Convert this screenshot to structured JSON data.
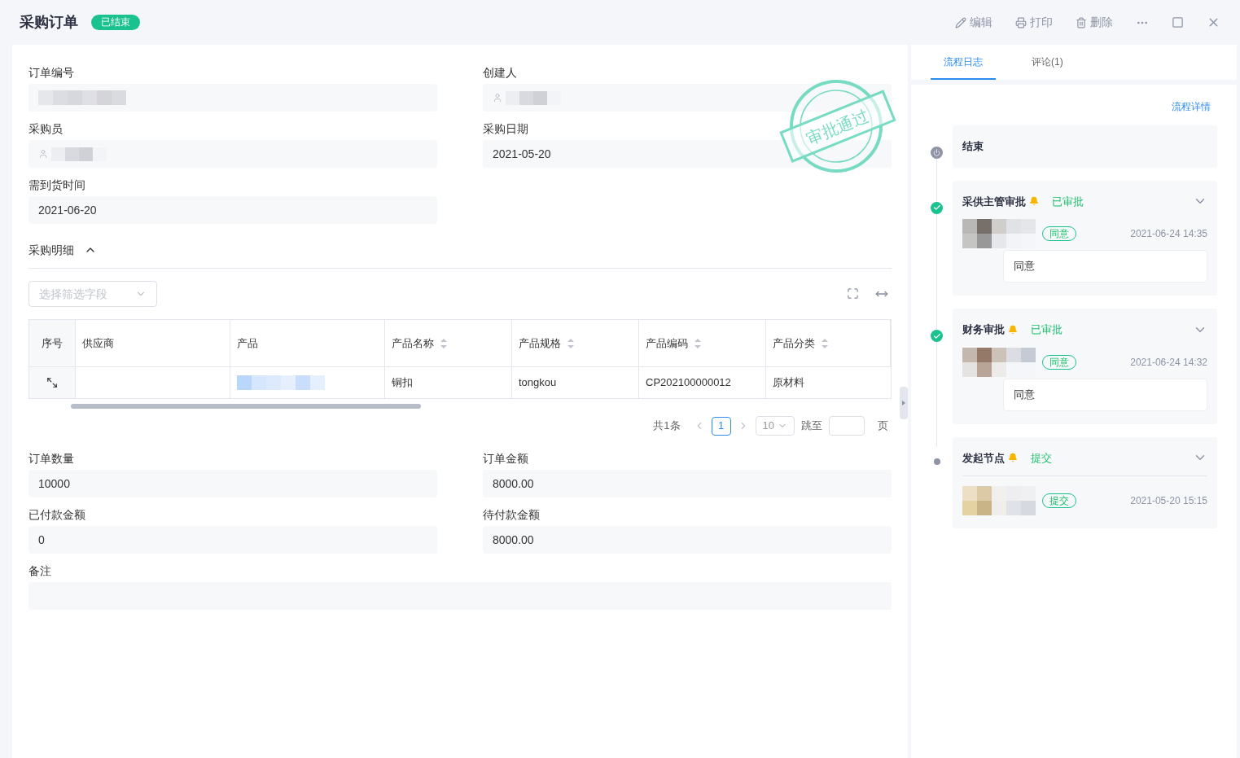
{
  "header": {
    "title": "采购订单",
    "status": "已结束",
    "actions": [
      {
        "kind": "edit",
        "label": "编辑"
      },
      {
        "kind": "print",
        "label": "打印"
      },
      {
        "kind": "delete",
        "label": "删除"
      }
    ]
  },
  "form_top": [
    {
      "label": "订单编号",
      "kind": "redacted"
    },
    {
      "label": "创建人",
      "kind": "user"
    },
    {
      "label": "采购员",
      "kind": "user"
    },
    {
      "label": "采购日期",
      "kind": "text",
      "value": "2021-05-20"
    },
    {
      "label": "需到货时间",
      "kind": "text",
      "value": "2021-06-20"
    }
  ],
  "stamp": {
    "text": "审批通过"
  },
  "details": {
    "title": "采购明细",
    "expanded": true,
    "filter": {
      "placeholder": "选择筛选字段"
    },
    "columns": [
      {
        "label": "序号",
        "sortable": false
      },
      {
        "label": "供应商",
        "sortable": false
      },
      {
        "label": "产品",
        "sortable": false
      },
      {
        "label": "产品名称",
        "sortable": true
      },
      {
        "label": "产品规格",
        "sortable": true
      },
      {
        "label": "产品编码",
        "sortable": true
      },
      {
        "label": "产品分类",
        "sortable": true
      }
    ],
    "rows": [
      {
        "supplier": "",
        "product_redacted": true,
        "name": "铜扣",
        "spec": "tongkou",
        "code": "CP202100000012",
        "category": "原材料"
      }
    ],
    "pagination": {
      "total": "共1条",
      "pages": [
        {
          "label": "1",
          "selected": true
        }
      ],
      "page_size": "10",
      "jump_label": "跳至",
      "page_suffix": "页"
    }
  },
  "form_bottom": [
    {
      "label": "订单数量",
      "value": "10000",
      "wide": false
    },
    {
      "label": "订单金额",
      "value": "8000.00",
      "wide": false
    },
    {
      "label": "已付款金额",
      "value": "0",
      "wide": false
    },
    {
      "label": "待付款金额",
      "value": "8000.00",
      "wide": false
    },
    {
      "label": "备注",
      "wide": true
    }
  ],
  "side": {
    "tabs": [
      {
        "label": "流程日志",
        "selected": true
      },
      {
        "label": "评论(1)",
        "selected": false
      }
    ],
    "detail_link": "流程详情",
    "nodes": [
      {
        "kind": "end",
        "title": "结束"
      },
      {
        "kind": "approved",
        "title": "采供主管审批",
        "status": "已审批",
        "records": [
          {
            "tag": "同意",
            "time": "2021-06-24 14:35",
            "comment": "同意"
          }
        ]
      },
      {
        "kind": "approved",
        "title": "财务审批",
        "status": "已审批",
        "records": [
          {
            "tag": "同意",
            "time": "2021-06-24 14:32",
            "comment": "同意"
          }
        ]
      },
      {
        "kind": "start",
        "title": "发起节点",
        "status": "提交",
        "records": [
          {
            "tag": "提交",
            "time": "2021-05-20 15:15"
          }
        ]
      }
    ]
  }
}
